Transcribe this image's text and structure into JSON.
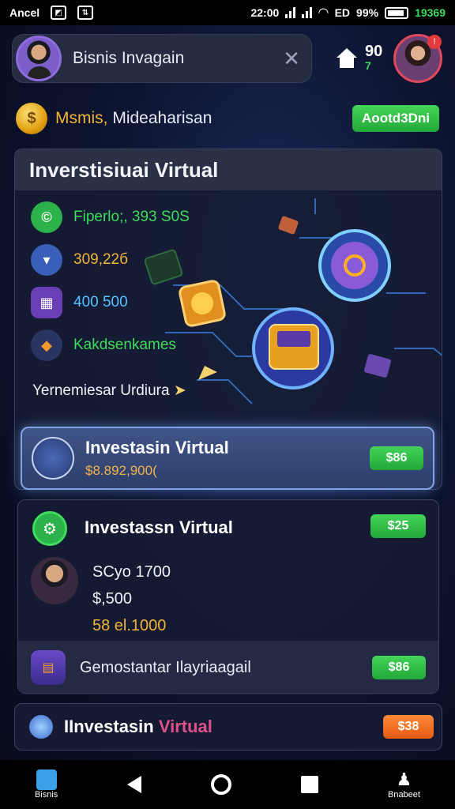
{
  "status_bar": {
    "carrier": "Ancel",
    "time": "22:00",
    "network": "ED",
    "battery": "99%",
    "extra": "19369"
  },
  "header": {
    "search_title": "Bisnis Invagain",
    "count_top": "90",
    "count_bottom": "7"
  },
  "coins": {
    "label_a": "Msmis,",
    "label_b": "Mideaharisan",
    "button": "Aootd3Dni"
  },
  "panel": {
    "title": "Inverstisiuai Virtual",
    "stats": [
      {
        "value": "Fiperlo;, 393 S0S",
        "color": "#3ddc5a",
        "icon_bg": "#2bb24a",
        "icon": "coin-icon"
      },
      {
        "value": "309,22б",
        "color": "#f3b335",
        "icon_bg": "#3a5fb8",
        "icon": "basket-icon"
      },
      {
        "value": "400 500",
        "color": "#53c2ff",
        "icon_bg": "#6a3fb5",
        "icon": "chart-icon"
      },
      {
        "value": "Kakdsenkames",
        "color": "#3ddc5a",
        "icon_bg": "#2a3460",
        "icon": "shield-icon"
      }
    ],
    "tagline": "Yernemiesar Urdiura"
  },
  "featured": {
    "title": "Investasin Virtual",
    "subtitle": "$8.892,900(",
    "button": "$86"
  },
  "card2": {
    "title": "Investassn Virtual",
    "button": "$25",
    "lines": [
      "SCyo 1700",
      "$,500",
      "58 el.1000"
    ],
    "footer_text": "Gemostantar Ilayriaagail",
    "footer_button": "$86"
  },
  "card3": {
    "title_a": "IInvestasin",
    "title_b": "Virtual",
    "button": "$38"
  },
  "nav": {
    "left_label": "Bisnis",
    "right_label": "Bnabeet"
  },
  "colors": {
    "accent_green": "#3ddc5a",
    "accent_gold": "#f3b335",
    "accent_orange": "#e45a12",
    "accent_pink": "#e0508a"
  }
}
